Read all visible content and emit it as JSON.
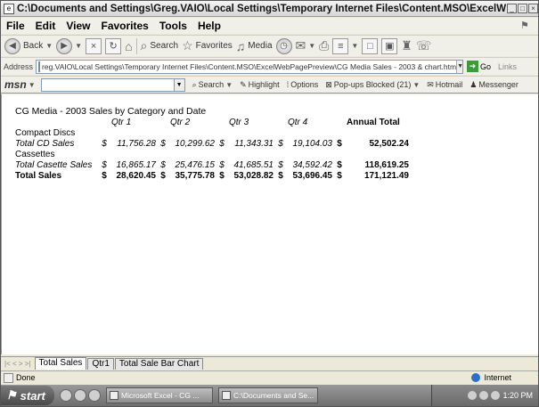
{
  "window": {
    "title": "C:\\Documents and Settings\\Greg.VAIO\\Local Settings\\Temporary Internet Files\\Content.MSO\\ExcelWe - Microsof..."
  },
  "menu": [
    "File",
    "Edit",
    "View",
    "Favorites",
    "Tools",
    "Help"
  ],
  "toolbar": {
    "back": "Back",
    "search": "Search",
    "favorites": "Favorites",
    "media": "Media"
  },
  "address": {
    "label": "Address",
    "value": "reg.VAIO\\Local Settings\\Temporary Internet Files\\Content.MSO\\ExcelWebPagePreview\\CG Media Sales - 2003 & chart.htm",
    "go": "Go",
    "links": "Links"
  },
  "msn": {
    "logo": "msn",
    "search": "Search",
    "highlight": "Highlight",
    "options": "Options",
    "popups": "Pop-ups Blocked (21)",
    "hotmail": "Hotmail",
    "messenger": "Messenger"
  },
  "sheet": {
    "title": "CG Media -  2003 Sales by Category and Date",
    "headers": [
      "Qtr 1",
      "Qtr 2",
      "Qtr 3",
      "Qtr 4",
      "Annual Total"
    ],
    "rows": [
      {
        "label": "Compact Discs",
        "type": "group"
      },
      {
        "label": "Total CD Sales",
        "type": "subtotal",
        "values": [
          "11,756.28",
          "10,299.62",
          "11,343.31",
          "19,104.03",
          "52,502.24"
        ]
      },
      {
        "label": "Cassettes",
        "type": "group"
      },
      {
        "label": "Total Casette Sales",
        "type": "subtotal",
        "values": [
          "16,865.17",
          "25,476.15",
          "41,685.51",
          "34,592.42",
          "118,619.25"
        ]
      },
      {
        "label": "Total Sales",
        "type": "total",
        "values": [
          "28,620.45",
          "35,775.78",
          "53,028.82",
          "53,696.45",
          "171,121.49"
        ]
      }
    ],
    "currency": "$"
  },
  "tabs": {
    "nav": "|< < > >|",
    "items": [
      "Total Sales",
      "Qtr1",
      "Total Sale Bar Chart"
    ],
    "active": 0
  },
  "status": {
    "text": "Done",
    "zone": "Internet"
  },
  "taskbar": {
    "start": "start",
    "tasks": [
      "Microsoft Excel - CG ...",
      "C:\\Documents and Se..."
    ],
    "clock": "1:20 PM"
  }
}
